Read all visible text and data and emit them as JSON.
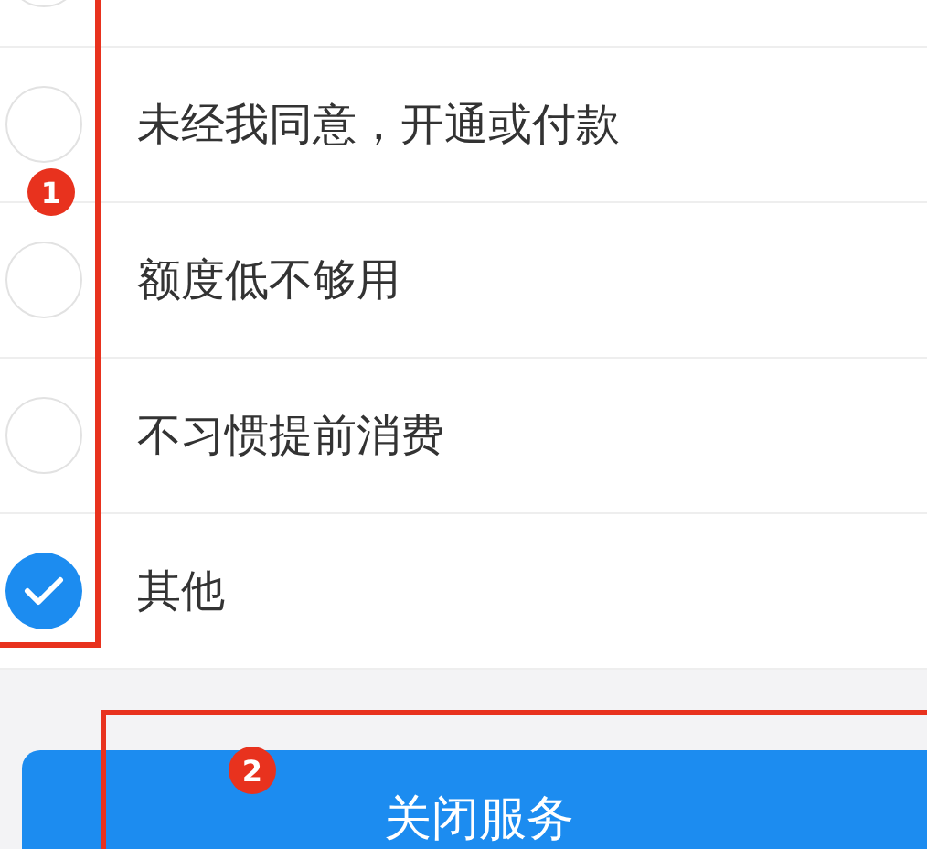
{
  "reasons": [
    {
      "selected": false
    },
    {
      "label": "未经我同意，开通或付款",
      "selected": false
    },
    {
      "label": "额度低不够用",
      "selected": false
    },
    {
      "label": "不习惯提前消费",
      "selected": false
    },
    {
      "label": "其他",
      "selected": true
    }
  ],
  "close_button": "关闭服务",
  "annotations": [
    {
      "label": "1"
    },
    {
      "label": "2"
    }
  ]
}
